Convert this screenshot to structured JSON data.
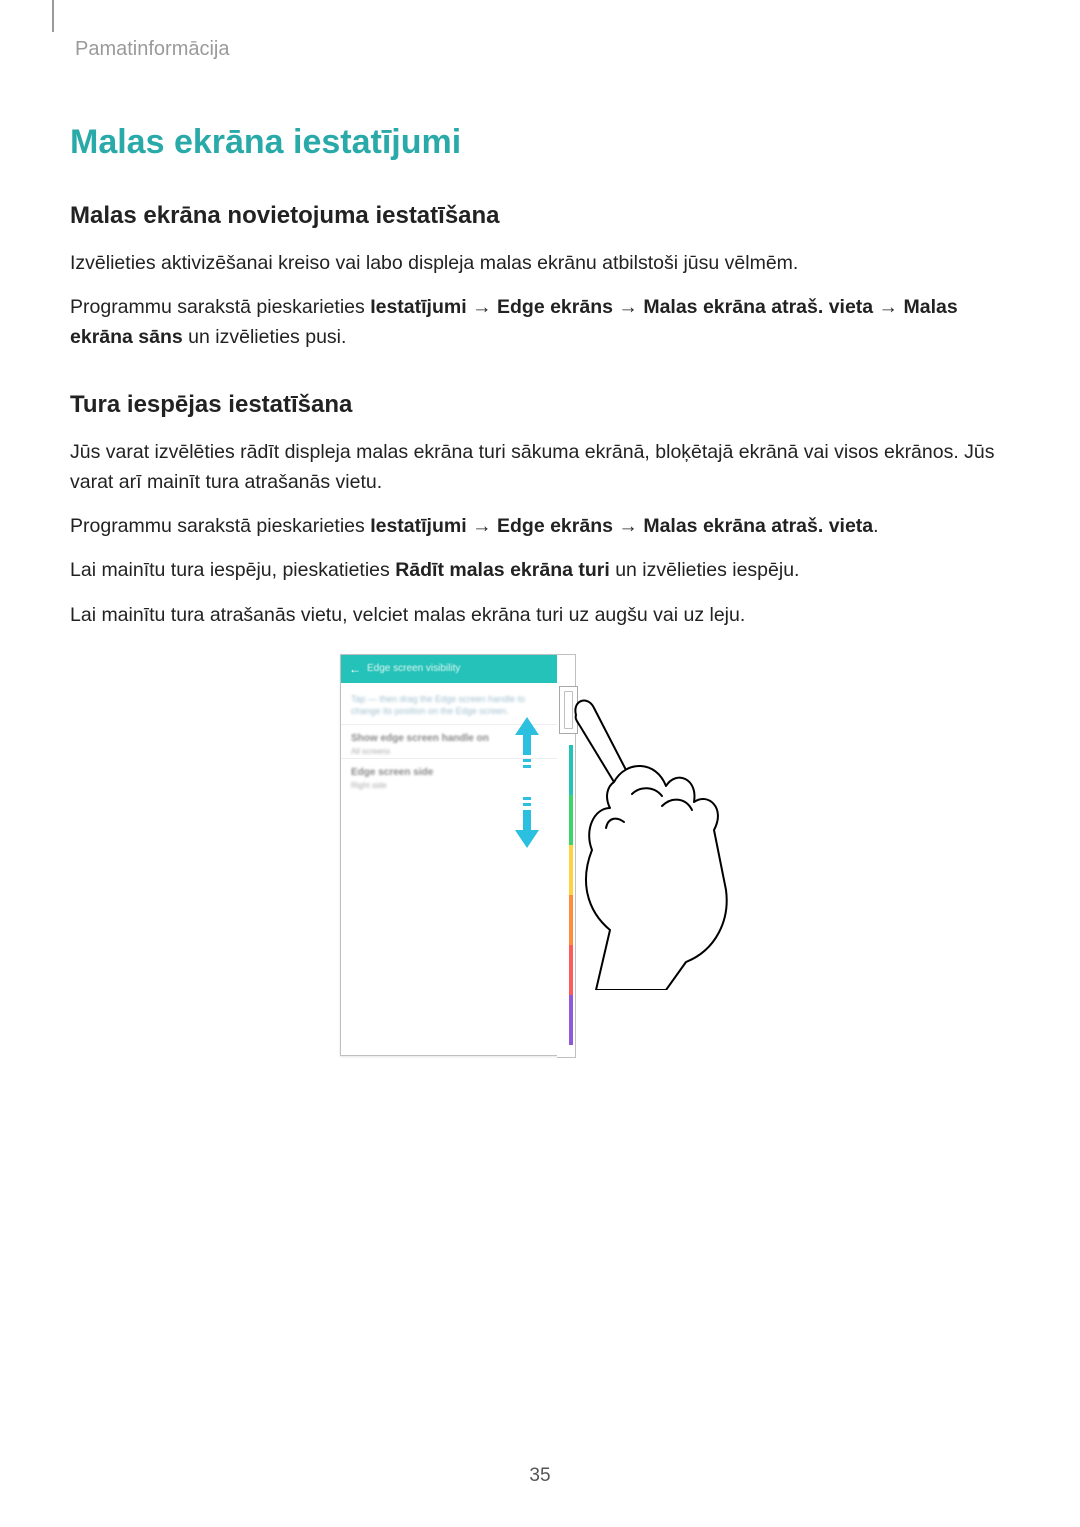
{
  "breadcrumb": "Pamatinformācija",
  "title": "Malas ekrāna iestatījumi",
  "section1": {
    "heading": "Malas ekrāna novietojuma iestatīšana",
    "p1": "Izvēlieties aktivizēšanai kreiso vai labo displeja malas ekrānu atbilstoši jūsu vēlmēm.",
    "p2_a": "Programmu sarakstā pieskarieties ",
    "p2_b1": "Iestatījumi",
    "p2_arrow": " → ",
    "p2_b2": "Edge ekrāns",
    "p2_b3": "Malas ekrāna atraš. vieta",
    "p2_b4": "Malas ekrāna sāns",
    "p2_c": " un izvēlieties pusi."
  },
  "section2": {
    "heading": "Tura iespējas iestatīšana",
    "p1": "Jūs varat izvēlēties rādīt displeja malas ekrāna turi sākuma ekrānā, bloķētajā ekrānā vai visos ekrānos. Jūs varat arī mainīt tura atrašanās vietu.",
    "p2_a": "Programmu sarakstā pieskarieties ",
    "p2_b1": "Iestatījumi",
    "p2_arrow": " → ",
    "p2_b2": "Edge ekrāns",
    "p2_b3": "Malas ekrāna atraš. vieta",
    "p2_end": ".",
    "p3_a": "Lai mainītu tura iespēju, pieskatieties ",
    "p3_b": "Rādīt malas ekrāna turi",
    "p3_c": " un izvēlieties iespēju.",
    "p4": "Lai mainītu tura atrašanās vietu, velciet malas ekrāna turi uz augšu vai uz leju."
  },
  "figure": {
    "toolbar_title": "Edge screen visibility",
    "hint_text": "Tap — then drag the Edge screen handle to change its position on the Edge screen.",
    "row1_label": "Show edge screen handle on",
    "row1_sub": "All screens",
    "row2_label": "Edge screen side",
    "row2_sub": "Right side",
    "edge_colors": [
      "#24c2b8",
      "#3bd46a",
      "#ffd23f",
      "#ff8c3a",
      "#ff5a5a",
      "#8e5ad8"
    ]
  },
  "page_number": "35"
}
